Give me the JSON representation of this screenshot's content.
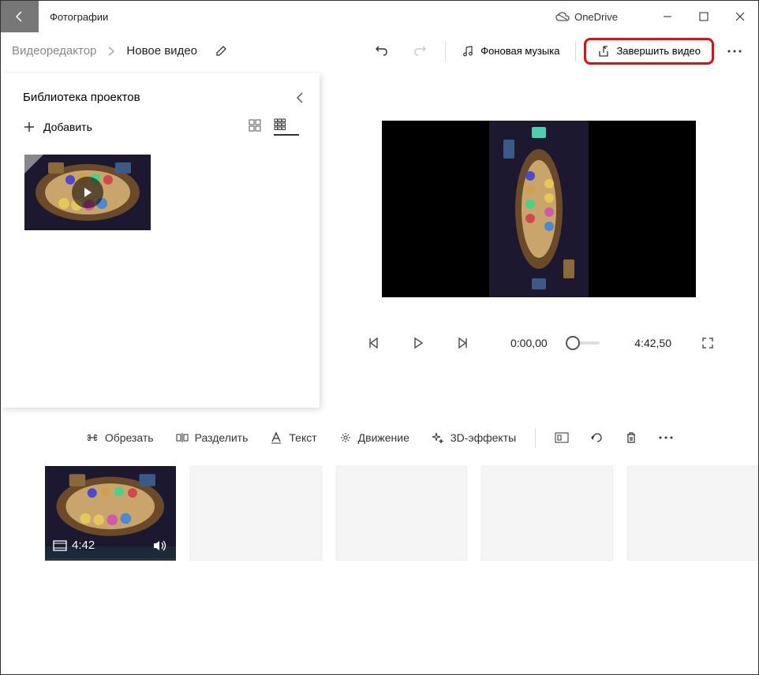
{
  "titlebar": {
    "app_name": "Фотографии",
    "onedrive": "OneDrive"
  },
  "cmdbar": {
    "breadcrumb1": "Видеоредактор",
    "breadcrumb2": "Новое видео",
    "bg_music": "Фоновая музыка",
    "finish": "Завершить видео"
  },
  "library": {
    "title": "Библиотека проектов",
    "add": "Добавить"
  },
  "player": {
    "current": "0:00,00",
    "total": "4:42,50"
  },
  "toolbar": {
    "trim": "Обрезать",
    "split": "Разделить",
    "text": "Текст",
    "motion": "Движение",
    "effects3d": "3D-эффекты"
  },
  "storyboard": {
    "clip_duration": "4:42"
  }
}
